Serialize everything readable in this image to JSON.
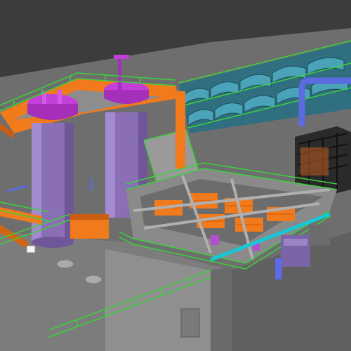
{
  "scene": {
    "kind": "3d-plant-bim-model",
    "palette": {
      "background": "#3c3c3c",
      "ground": "#7a7a7a",
      "concrete": "#8e8e8e",
      "tank_body": "#8a6fb5",
      "tank_top": "#c23fd8",
      "steel_orange": "#f07a1c",
      "railing_green": "#3bd23b",
      "glass_roof": "#3d8fa5",
      "pipe_blue": "#5b6be0",
      "pipe_cyan": "#18c7d6",
      "frame_black": "#1a1a1a"
    },
    "labels": []
  }
}
